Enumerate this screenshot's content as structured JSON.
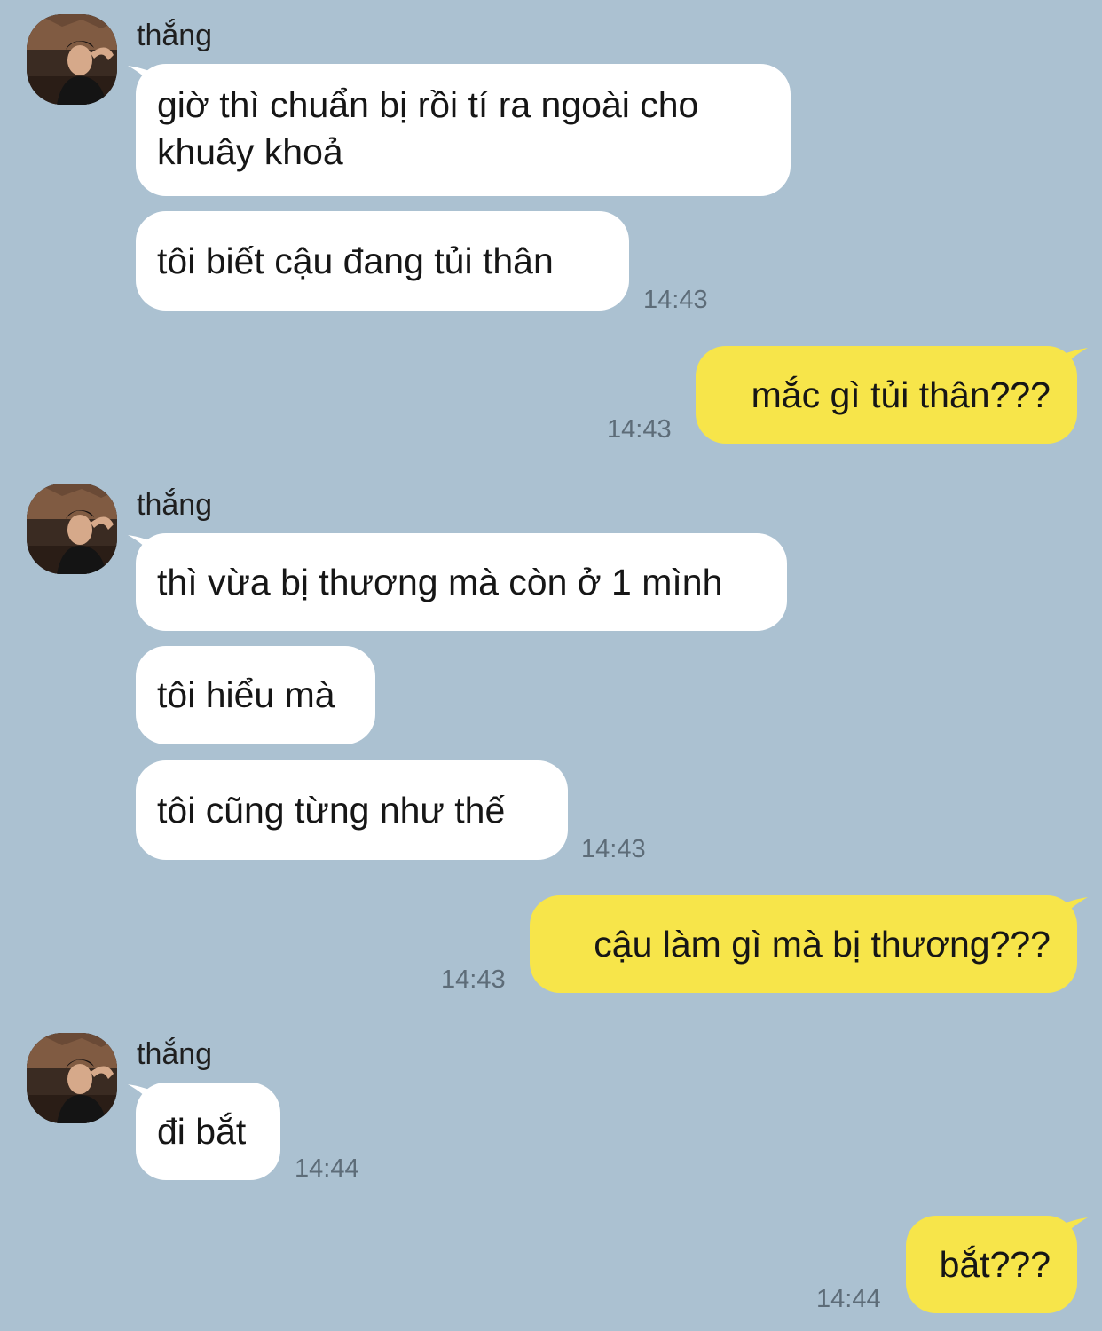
{
  "contact": {
    "name": "thắng"
  },
  "groups": [
    {
      "sender": "thắng",
      "messages": [
        "giờ thì chuẩn bị rồi tí ra ngoài cho khuây khoả",
        "tôi biết cậu đang tủi thân"
      ],
      "time": "14:43"
    },
    {
      "sender": "me",
      "messages": [
        "mắc gì tủi thân???"
      ],
      "time": "14:43"
    },
    {
      "sender": "thắng",
      "messages": [
        "thì vừa bị thương mà còn ở 1 mình",
        "tôi hiểu mà",
        "tôi cũng từng như thế"
      ],
      "time": "14:43"
    },
    {
      "sender": "me",
      "messages": [
        "cậu làm gì mà bị thương???"
      ],
      "time": "14:43"
    },
    {
      "sender": "thắng",
      "messages": [
        "đi bắt"
      ],
      "time": "14:44"
    },
    {
      "sender": "me",
      "messages": [
        "bắt???"
      ],
      "time": "14:44"
    }
  ],
  "colors": {
    "background": "#abc1d1",
    "incoming_bubble": "#ffffff",
    "outgoing_bubble": "#f7e54a",
    "timestamp": "#5d6c78"
  }
}
